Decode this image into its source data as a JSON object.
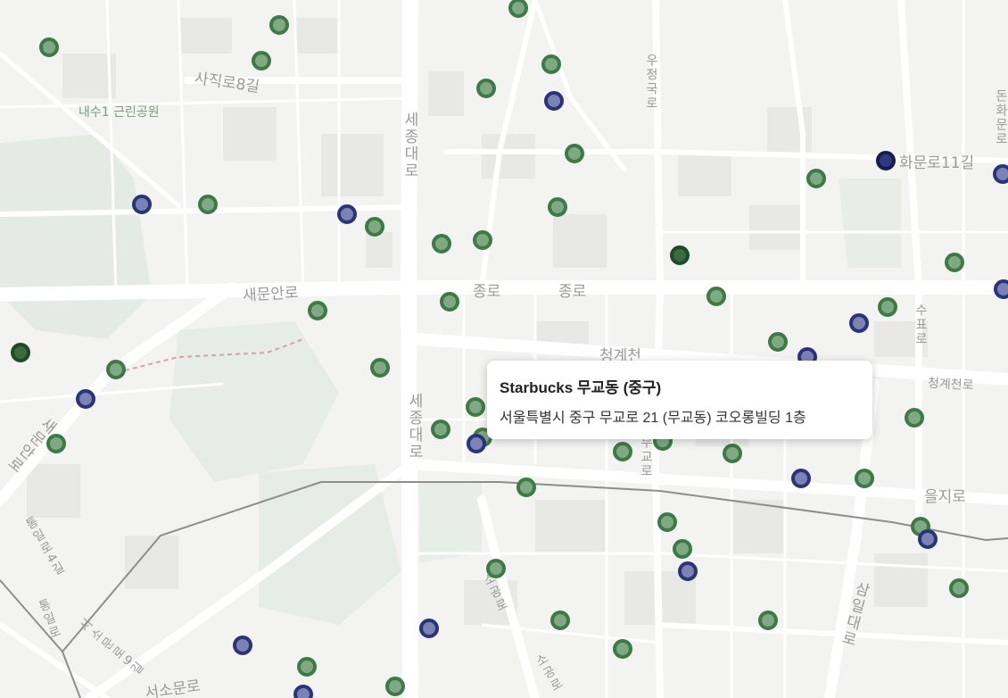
{
  "map": {
    "labels": {
      "sajik8": "사직로8길",
      "naesu_park": "내수1 근린공원",
      "sejong_n": "세종대로",
      "ujeongguk": "우정국로",
      "hwamun11": "화문로11길",
      "donhwamun": "돈화문로",
      "saemunan": "새문안로",
      "jongno1": "종로",
      "jongno2": "종로",
      "cheonggye": "청계천",
      "cheonggye_ro": "청계천로",
      "sejong_s": "세종대로",
      "suporo": "수표로",
      "euljiro": "을지로",
      "saemunan_v": "새문안로",
      "tongil4": "통일로4길",
      "tongil": "통일로",
      "sosomun9": "서소문로9길",
      "sosomun": "서소문로",
      "sogong": "소공로",
      "sogong2": "소공로",
      "samil": "삼일대로",
      "mugyo": "무교로"
    },
    "marker_colors": {
      "green": "#3d7a45",
      "blue": "#2a3579"
    }
  },
  "popup": {
    "title": "Starbucks 무교동 (중구)",
    "address": "서울특별시 중구 무교로 21 (무교동) 코오롱빌딩 1층"
  }
}
